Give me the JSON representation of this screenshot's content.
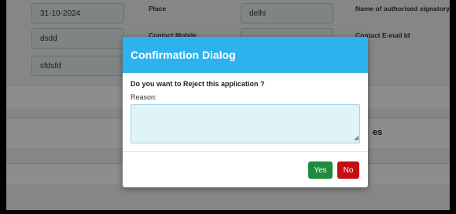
{
  "form": {
    "date_value": "31-10-2024",
    "place_label": "Place",
    "place_value": "delhi",
    "signatory_label": "Name of authorised signatory",
    "field_a_value": "dsdd",
    "contact_mobile_label": "Contact Mobile",
    "contact_email_label": "Contact E-mail Id",
    "field_b_value": "sfdsfd",
    "section_heading_fragment": "es"
  },
  "dialog": {
    "title": "Confirmation Dialog",
    "question": "Do you want to Reject this application ?",
    "reason_label": "Reason:",
    "reason_value": "",
    "yes_label": "Yes",
    "no_label": "No",
    "colors": {
      "header": "#2cb2ee",
      "yes": "#1e8c3c",
      "no": "#c20f14"
    }
  }
}
